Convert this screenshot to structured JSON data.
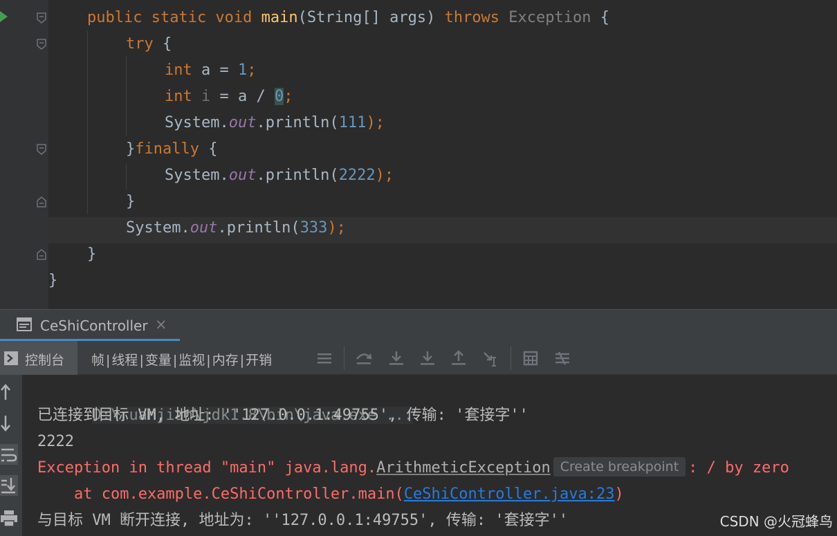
{
  "editor": {
    "lines": [
      {
        "indent": "    ",
        "tokens": [
          {
            "t": "public static void ",
            "c": "kw"
          },
          {
            "t": "main",
            "c": "fn"
          },
          {
            "t": "(String[] args) ",
            "c": ""
          },
          {
            "t": "throws ",
            "c": "kw"
          },
          {
            "t": "Exception",
            "c": "dim"
          },
          {
            "t": " {",
            "c": ""
          }
        ]
      },
      {
        "indent": "        ",
        "tokens": [
          {
            "t": "try",
            "c": "kw"
          },
          {
            "t": " {",
            "c": ""
          }
        ]
      },
      {
        "indent": "            ",
        "tokens": [
          {
            "t": "int",
            "c": "kw"
          },
          {
            "t": " a = ",
            "c": ""
          },
          {
            "t": "1",
            "c": "num"
          },
          {
            "t": ";",
            "c": "kw"
          }
        ]
      },
      {
        "indent": "            ",
        "tokens": [
          {
            "t": "int",
            "c": "kw"
          },
          {
            "t": " ",
            "c": ""
          },
          {
            "t": "i",
            "c": "unused"
          },
          {
            "t": " = a / ",
            "c": ""
          },
          {
            "t": "0",
            "c": "hl0"
          },
          {
            "t": ";",
            "c": "kw"
          }
        ]
      },
      {
        "indent": "            ",
        "tokens": [
          {
            "t": "System.",
            "c": ""
          },
          {
            "t": "out",
            "c": "fld"
          },
          {
            "t": ".println(",
            "c": ""
          },
          {
            "t": "111",
            "c": "num"
          },
          {
            "t": ");",
            "c": "kw"
          }
        ]
      },
      {
        "indent": "        ",
        "tokens": [
          {
            "t": "}",
            "c": ""
          },
          {
            "t": "finally",
            "c": "kw"
          },
          {
            "t": " {",
            "c": ""
          }
        ]
      },
      {
        "indent": "            ",
        "tokens": [
          {
            "t": "System.",
            "c": ""
          },
          {
            "t": "out",
            "c": "fld"
          },
          {
            "t": ".println(",
            "c": ""
          },
          {
            "t": "2222",
            "c": "num"
          },
          {
            "t": ");",
            "c": "kw"
          }
        ]
      },
      {
        "indent": "        ",
        "tokens": [
          {
            "t": "}",
            "c": ""
          }
        ]
      },
      {
        "indent": "        ",
        "tokens": [
          {
            "t": "System.",
            "c": ""
          },
          {
            "t": "out",
            "c": "fld"
          },
          {
            "t": ".println(",
            "c": ""
          },
          {
            "t": "333",
            "c": "num"
          },
          {
            "t": ");",
            "c": "kw"
          }
        ]
      },
      {
        "indent": "    ",
        "tokens": [
          {
            "t": "}",
            "c": ""
          }
        ]
      },
      {
        "indent": "",
        "tokens": [
          {
            "t": "}",
            "c": ""
          }
        ]
      }
    ]
  },
  "run_tab": {
    "title": "CeShiController",
    "close": "×"
  },
  "toolbar": {
    "console_label": "控制台",
    "debug_tabs": [
      "帧",
      "线程",
      "变量",
      "监视",
      "内存",
      "开销"
    ],
    "separator": "|"
  },
  "console": {
    "command": "D:\\ruanjian\\jdk1.8\\bin\\java.exe ...",
    "connected": "已连接到目标 VM, 地址: ''127.0.0.1:49755', 传输: '套接字''",
    "output": "2222",
    "exception": {
      "prefix": "Exception in thread \"main\" java.lang.",
      "class_name": "ArithmeticException",
      "hint": "Create breakpoint",
      "suffix": ": / by zero"
    },
    "stack": {
      "prefix": "    at com.example.CeShiController.main(",
      "link": "CeShiController.java:23",
      "suffix": ")"
    },
    "disconnected": "与目标 VM 断开连接, 地址为: ''127.0.0.1:49755', 传输: '套接字''"
  },
  "watermark": "CSDN @火冠蜂鸟",
  "colors": {
    "keyword": "#cc7832",
    "function": "#ffc66d",
    "number": "#6897bb",
    "field": "#9876aa",
    "error": "#ff6b68",
    "link": "#287bde"
  }
}
